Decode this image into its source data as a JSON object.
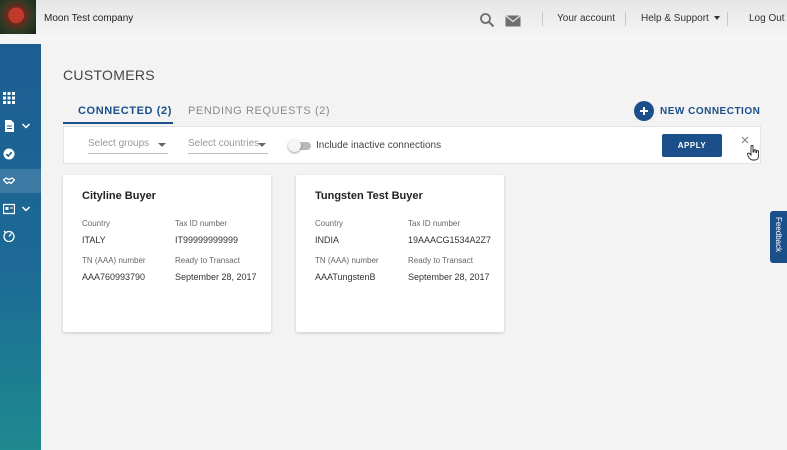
{
  "topbar": {
    "company": "Moon Test company",
    "account_link": "Your account",
    "help_link": "Help & Support",
    "logout_link": "Log Out"
  },
  "icons": {
    "search": "search-icon",
    "mail": "mail-icon",
    "rail": [
      "grid-icon",
      "document-icon",
      "check-circle-icon",
      "handshake-icon",
      "card-icon",
      "dashboard-icon"
    ]
  },
  "page": {
    "title": "CUSTOMERS"
  },
  "tabs": [
    {
      "label": "CONNECTED (2)",
      "active": true
    },
    {
      "label": "PENDING REQUESTS (2)",
      "active": false
    }
  ],
  "actions": {
    "new_connection": "NEW CONNECTION"
  },
  "filters": {
    "groups_placeholder": "Select groups",
    "countries_placeholder": "Select countries",
    "include_inactive_label": "Include inactive connections",
    "include_inactive_on": false,
    "apply_label": "APPLY"
  },
  "cards": [
    {
      "name": "Cityline Buyer",
      "country_label": "Country",
      "country": "ITALY",
      "tax_label": "Tax ID number",
      "tax": "IT99999999999",
      "tn_label": "TN (AAA) number",
      "tn": "AAA760993790",
      "ready_label": "Ready to Transact",
      "ready": "September 28, 2017"
    },
    {
      "name": "Tungsten Test Buyer",
      "country_label": "Country",
      "country": "INDIA",
      "tax_label": "Tax ID number",
      "tax": "19AAACG1534A2Z7",
      "tn_label": "TN (AAA) number",
      "tn": "AAATungstenB",
      "ready_label": "Ready to Transact",
      "ready": "September 28, 2017"
    }
  ],
  "feedback": {
    "label": "Feedback"
  },
  "colors": {
    "primary": "#1b4f8a",
    "rail_top": "#1d5d92",
    "rail_bottom": "#1f8a8f"
  }
}
